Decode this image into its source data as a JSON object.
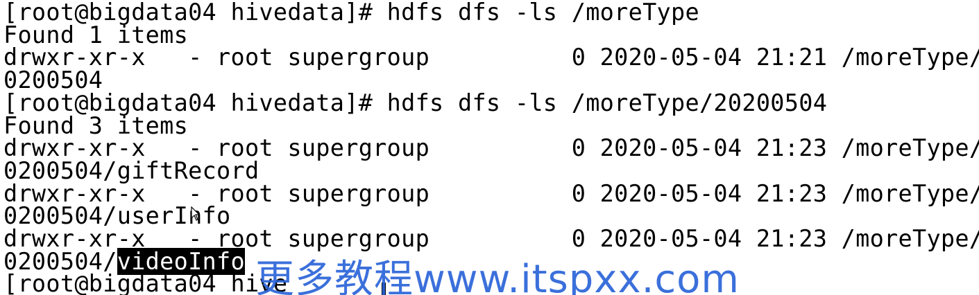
{
  "terminal": {
    "lines": [
      {
        "segments": [
          {
            "text": "[root@bigdata04 hivedata]# hdfs dfs -ls /moreType",
            "selected": false
          }
        ]
      },
      {
        "segments": [
          {
            "text": "Found 1 items",
            "selected": false
          }
        ]
      },
      {
        "segments": [
          {
            "text": "drwxr-xr-x   - root supergroup          0 2020-05-04 21:21 /moreType/2",
            "selected": false
          }
        ]
      },
      {
        "segments": [
          {
            "text": "0200504",
            "selected": false
          }
        ]
      },
      {
        "segments": [
          {
            "text": "[root@bigdata04 hivedata]# hdfs dfs -ls /moreType/20200504",
            "selected": false
          }
        ]
      },
      {
        "segments": [
          {
            "text": "Found 3 items",
            "selected": false
          }
        ]
      },
      {
        "segments": [
          {
            "text": "drwxr-xr-x   - root supergroup          0 2020-05-04 21:23 /moreType/2",
            "selected": false
          }
        ]
      },
      {
        "segments": [
          {
            "text": "0200504/giftRecord",
            "selected": false
          }
        ]
      },
      {
        "segments": [
          {
            "text": "drwxr-xr-x   - root supergroup          0 2020-05-04 21:23 /moreType/2",
            "selected": false
          }
        ]
      },
      {
        "segments": [
          {
            "text": "0200504/userInfo",
            "selected": false
          }
        ]
      },
      {
        "segments": [
          {
            "text": "drwxr-xr-x   - root supergroup          0 2020-05-04 21:23 /moreType/2",
            "selected": false
          }
        ]
      },
      {
        "segments": [
          {
            "text": "0200504/",
            "selected": false
          },
          {
            "text": "videoInfo",
            "selected": true
          }
        ]
      },
      {
        "segments": [
          {
            "text": "[root@bigdata04 hive",
            "selected": false
          }
        ]
      }
    ]
  },
  "watermark": {
    "text": "更多教程www.itspxx.com"
  },
  "colors": {
    "background": "#ffffff",
    "text": "#000000",
    "selection_bg": "#000000",
    "selection_fg": "#ffffff",
    "watermark": "#2b64d8"
  },
  "icons": {
    "mouse_pointer": "arrow-cursor-icon",
    "text_cursor": "text-caret-icon"
  }
}
